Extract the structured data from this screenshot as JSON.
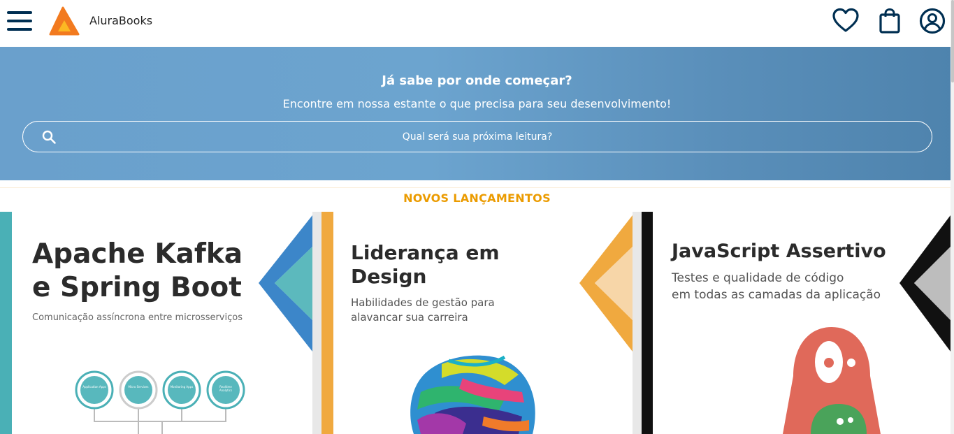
{
  "header": {
    "brand": "AluraBooks"
  },
  "banner": {
    "title": "Já sabe por onde começar?",
    "subtitle": "Encontre em nossa estante o que precisa para seu desenvolvimento!",
    "search_placeholder": "Qual será sua próxima leitura?"
  },
  "section": {
    "title": "NOVOS LANÇAMENTOS"
  },
  "books": [
    {
      "title_line1": "Apache Kafka",
      "title_line2": "e Spring Boot",
      "subtitle": "Comunicação assíncrona entre microsserviços",
      "accent": "#4ab0b6",
      "badges": [
        "Application Apps",
        "Micro Services",
        "Monitoring Apps",
        "Realtime Analytics"
      ]
    },
    {
      "title_line1": "Liderança em",
      "title_line2": "Design",
      "subtitle_line1": "Habilidades de gestão para",
      "subtitle_line2": "alavancar sua carreira",
      "accent": "#f0a93f"
    },
    {
      "title_line1": "JavaScript Assertivo",
      "subtitle_line1": "Testes e qualidade de código",
      "subtitle_line2": "em todas as camadas da aplicação",
      "accent": "#111111"
    }
  ],
  "colors": {
    "header_icon": "#002f52",
    "section_title": "#eb9b00",
    "logo_orange": "#f27a1f",
    "logo_yellow": "#fcb823"
  }
}
